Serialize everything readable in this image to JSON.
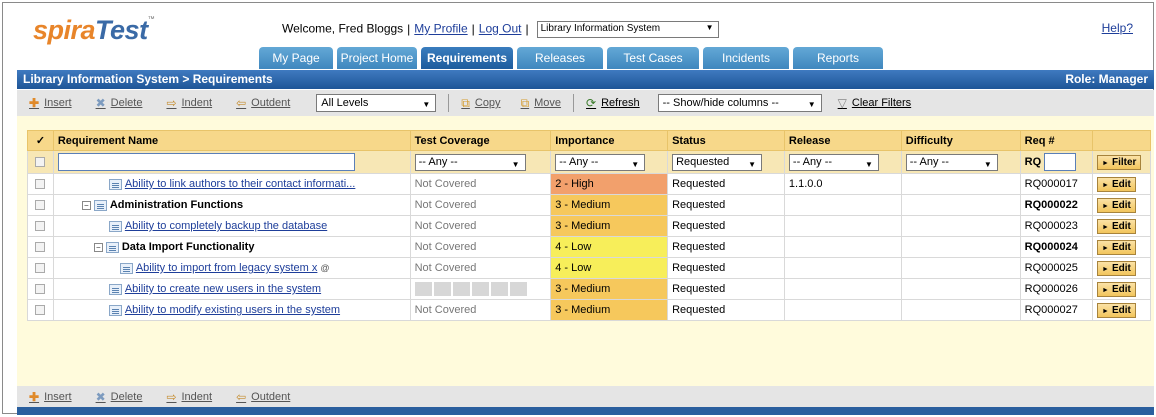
{
  "logo": {
    "part1": "spira",
    "part2": "Test",
    "tm": "™"
  },
  "header": {
    "welcome": "Welcome, Fred Bloggs",
    "my_profile": "My Profile",
    "log_out": "Log Out",
    "project": "Library Information System",
    "help": "Help?"
  },
  "tabs": [
    {
      "label": "My Page"
    },
    {
      "label": "Project Home"
    },
    {
      "label": "Requirements"
    },
    {
      "label": "Releases"
    },
    {
      "label": "Test Cases"
    },
    {
      "label": "Incidents"
    },
    {
      "label": "Reports"
    }
  ],
  "titlebar": {
    "title": "Library Information System > Requirements",
    "role": "Role: Manager"
  },
  "toolbar": {
    "insert": "Insert",
    "delete": "Delete",
    "indent": "Indent",
    "outdent": "Outdent",
    "levels": "All Levels",
    "copy": "Copy",
    "move": "Move",
    "refresh": "Refresh",
    "show_hide": "-- Show/hide columns --",
    "clear_filters": "Clear Filters"
  },
  "grid": {
    "headers": {
      "check": "✓",
      "name": "Requirement Name",
      "coverage": "Test Coverage",
      "importance": "Importance",
      "status": "Status",
      "release": "Release",
      "difficulty": "Difficulty",
      "reqnum": "Req #"
    },
    "filters": {
      "coverage": "-- Any --",
      "importance": "-- Any --",
      "status": "Requested",
      "release": "-- Any --",
      "difficulty": "-- Any --",
      "rq": "RQ",
      "filter_btn": "Filter"
    },
    "rows": [
      {
        "name": "Ability to link authors to their contact informati...",
        "coverage": "Not Covered",
        "importance": "2 - High",
        "status": "Requested",
        "release": "1.1.0.0",
        "id": "RQ000017",
        "edit": "Edit"
      },
      {
        "name": "Administration Functions",
        "coverage": "Not Covered",
        "importance": "3 - Medium",
        "status": "Requested",
        "release": "",
        "id": "RQ000022",
        "edit": "Edit"
      },
      {
        "name": "Ability to completely backup the database",
        "coverage": "Not Covered",
        "importance": "3 - Medium",
        "status": "Requested",
        "release": "",
        "id": "RQ000023",
        "edit": "Edit"
      },
      {
        "name": "Data Import Functionality",
        "coverage": "Not Covered",
        "importance": "4 - Low",
        "status": "Requested",
        "release": "",
        "id": "RQ000024",
        "edit": "Edit"
      },
      {
        "name": "Ability to import from legacy system x",
        "coverage": "Not Covered",
        "importance": "4 - Low",
        "status": "Requested",
        "release": "",
        "id": "RQ000025",
        "edit": "Edit"
      },
      {
        "name": "Ability to create new users in the system",
        "coverage": "",
        "importance": "3 - Medium",
        "status": "Requested",
        "release": "",
        "id": "RQ000026",
        "edit": "Edit"
      },
      {
        "name": "Ability to modify existing users in the system",
        "coverage": "Not Covered",
        "importance": "3 - Medium",
        "status": "Requested",
        "release": "",
        "id": "RQ000027",
        "edit": "Edit"
      }
    ]
  },
  "bottom": {
    "insert": "Insert",
    "delete": "Delete",
    "indent": "Indent",
    "outdent": "Outdent"
  },
  "colors": {
    "accent": "#2a5f9e",
    "tab": "#4a90c8",
    "header_row": "#f7d88a",
    "content_bg": "#fffbdc"
  }
}
